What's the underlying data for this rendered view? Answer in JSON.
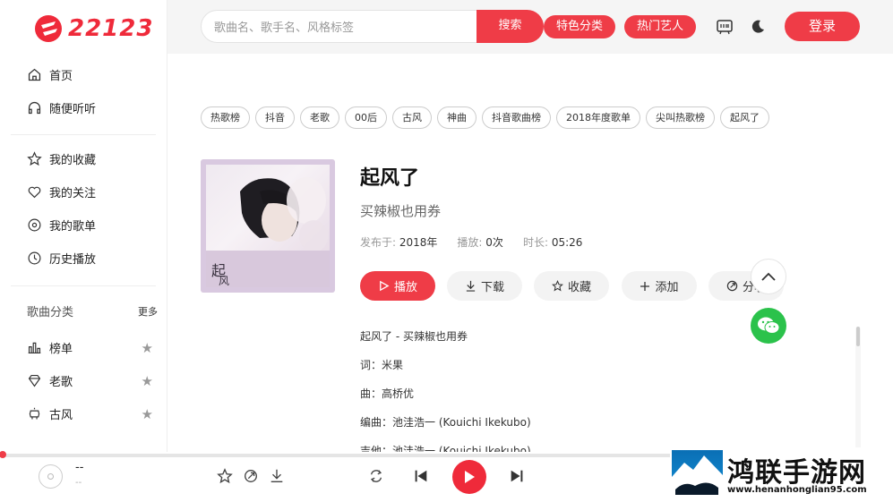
{
  "brand": {
    "logo_text": "22123",
    "accent": "#ef3c47"
  },
  "sidebar": {
    "main": [
      {
        "label": "首页",
        "icon": "home-icon"
      },
      {
        "label": "随便听听",
        "icon": "headphones-icon"
      }
    ],
    "mine": [
      {
        "label": "我的收藏",
        "icon": "star-icon"
      },
      {
        "label": "我的关注",
        "icon": "heart-icon"
      },
      {
        "label": "我的歌单",
        "icon": "disc-icon"
      },
      {
        "label": "历史播放",
        "icon": "clock-icon"
      }
    ],
    "category_title": "歌曲分类",
    "category_more": "更多",
    "categories": [
      {
        "label": "榜单",
        "icon": "chart-icon"
      },
      {
        "label": "老歌",
        "icon": "diamond-icon"
      },
      {
        "label": "古风",
        "icon": "lantern-icon"
      }
    ]
  },
  "topbar": {
    "search_placeholder": "歌曲名、歌手名、风格标签",
    "search_button": "搜索",
    "pill_features": "特色分类",
    "pill_artists": "热门艺人",
    "login": "登录"
  },
  "tags": [
    "热歌榜",
    "抖音",
    "老歌",
    "00后",
    "古风",
    "神曲",
    "抖音歌曲榜",
    "2018年度歌单",
    "尖叫热歌榜",
    "起风了"
  ],
  "song": {
    "title": "起风了",
    "artist": "买辣椒也用券",
    "released_label": "发布于:",
    "released": "2018年",
    "plays_label": "播放:",
    "plays": "0次",
    "duration_label": "时长:",
    "duration": "05:26",
    "cover_text": "起风了"
  },
  "actions": {
    "play": "播放",
    "download": "下载",
    "favorite": "收藏",
    "add": "添加",
    "share": "分享"
  },
  "lyrics": [
    "起风了 - 买辣椒也用券",
    "词：米果",
    "曲：高桥优",
    "编曲：池洼浩一 (Kouichi Ikekubo)",
    "吉他：池洼浩一 (Kouichi Ikekubo)"
  ],
  "player": {
    "title": "--",
    "subtitle": "--"
  },
  "watermark": {
    "title": "鸿联手游网",
    "url": "www.henanhonglian95.com"
  }
}
